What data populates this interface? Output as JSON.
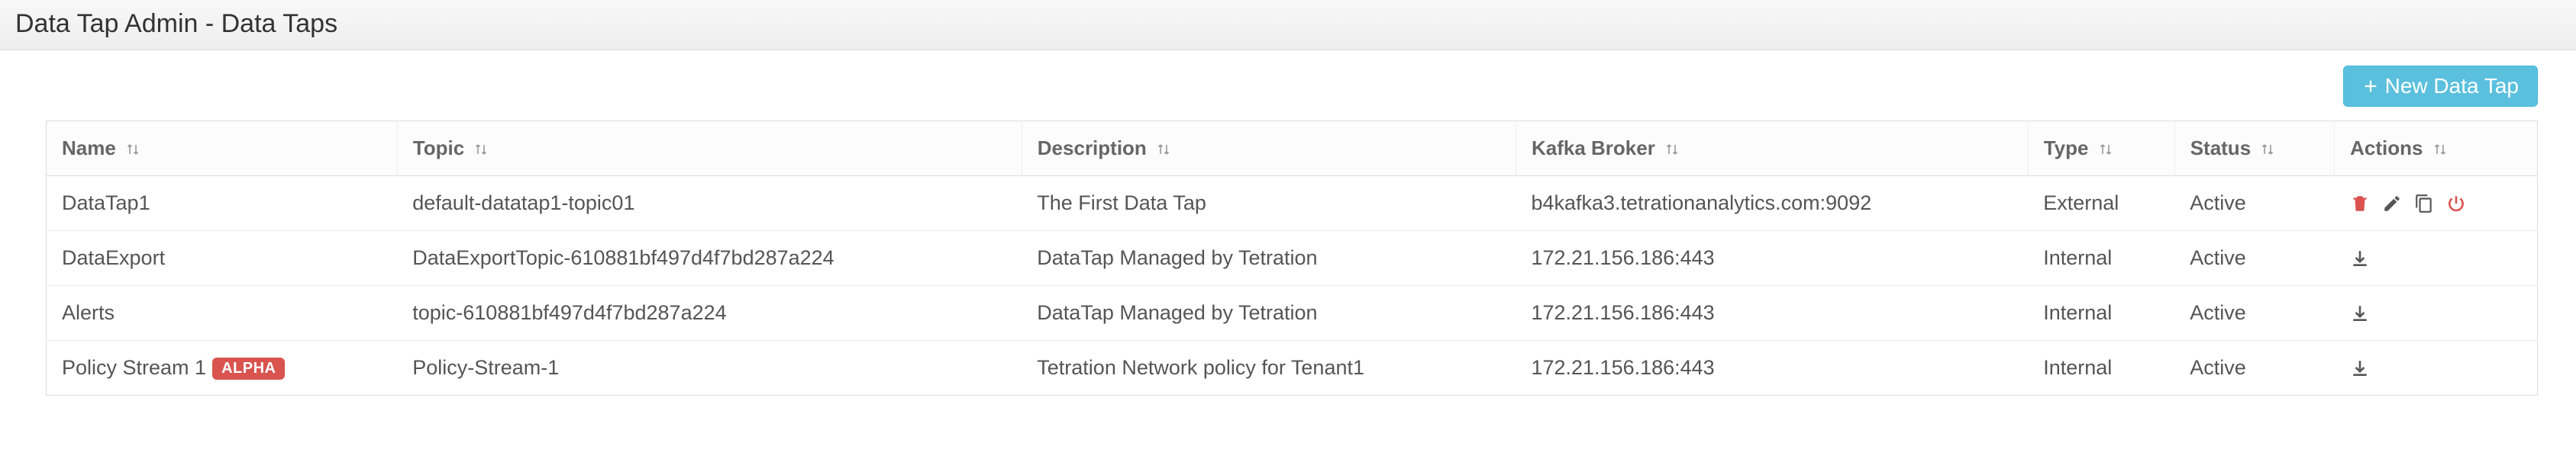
{
  "page_title": "Data Tap Admin - Data Taps",
  "toolbar": {
    "new_button_label": "New Data Tap"
  },
  "columns": {
    "name": "Name",
    "topic": "Topic",
    "description": "Description",
    "kafka_broker": "Kafka Broker",
    "type": "Type",
    "status": "Status",
    "actions": "Actions"
  },
  "rows": [
    {
      "name": "DataTap1",
      "badge": null,
      "topic": "default-datatap1-topic01",
      "description": "The First Data Tap",
      "kafka_broker": "b4kafka3.tetrationanalytics.com:9092",
      "type": "External",
      "status": "Active",
      "actions_kind": "external"
    },
    {
      "name": "DataExport",
      "badge": null,
      "topic": "DataExportTopic-610881bf497d4f7bd287a224",
      "description": "DataTap Managed by Tetration",
      "kafka_broker": "172.21.156.186:443",
      "type": "Internal",
      "status": "Active",
      "actions_kind": "internal"
    },
    {
      "name": "Alerts",
      "badge": null,
      "topic": "topic-610881bf497d4f7bd287a224",
      "description": "DataTap Managed by Tetration",
      "kafka_broker": "172.21.156.186:443",
      "type": "Internal",
      "status": "Active",
      "actions_kind": "internal"
    },
    {
      "name": "Policy Stream 1",
      "badge": "ALPHA",
      "topic": "Policy-Stream-1",
      "description": "Tetration Network policy for Tenant1",
      "kafka_broker": "172.21.156.186:443",
      "type": "Internal",
      "status": "Active",
      "actions_kind": "internal"
    }
  ]
}
